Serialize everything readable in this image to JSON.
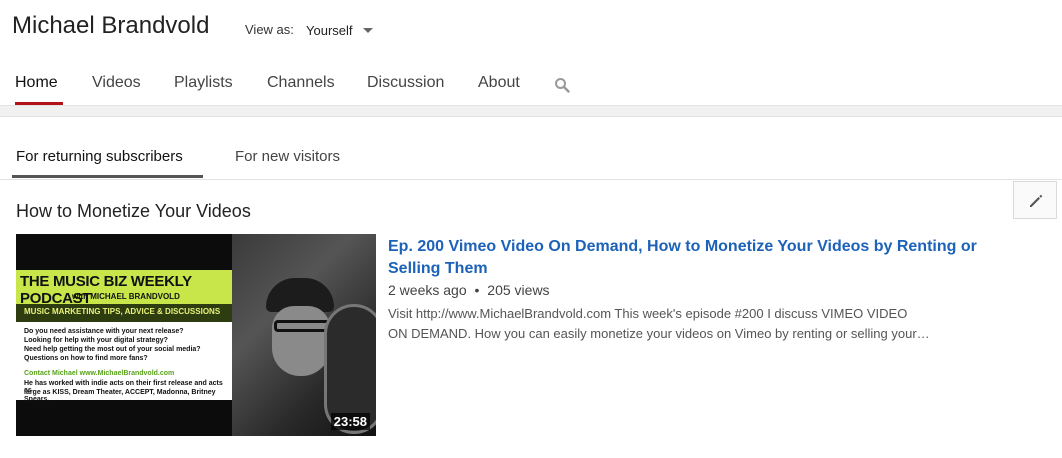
{
  "channel": {
    "title": "Michael Brandvold",
    "view_as_label": "View as:",
    "view_as_value": "Yourself"
  },
  "nav": {
    "tabs": [
      "Home",
      "Videos",
      "Playlists",
      "Channels",
      "Discussion",
      "About"
    ],
    "active": "Home",
    "search_icon": "search-icon"
  },
  "subtabs": {
    "items": [
      "For returning subscribers",
      "For new visitors"
    ],
    "active": "For returning subscribers"
  },
  "section": {
    "title": "How to Monetize Your Videos",
    "edit_icon": "pencil-icon"
  },
  "video": {
    "title_line1": "Ep. 200 Vimeo Video On Demand, How to Monetize Your Videos by Renting or",
    "title_line2": "Selling Them",
    "age": "2 weeks ago",
    "separator": "•",
    "views": "205 views",
    "description_line1": "Visit http://www.MichaelBrandvold.com This week's episode #200 I discuss VIMEO VIDEO",
    "description_line2": "ON DEMAND. How you can easily monetize your videos on Vimeo by renting or selling your…",
    "duration": "23:58",
    "thumbnail": {
      "title": "THE MUSIC BIZ WEEKLY PODCAST",
      "subtitle": "with MICHAEL BRANDVOLD",
      "band": "MUSIC MARKETING TIPS, ADVICE & DISCUSSIONS",
      "q1": "Do you need assistance with your next release?",
      "q2": "Looking for help with your digital strategy?",
      "q3": "Need help getting the most out of your social media?",
      "q4": "Questions on how to find more fans?",
      "contact": "Contact Michael www.MichaelBrandvold.com",
      "bio1": "He has worked with indie acts on their first release and acts as",
      "bio2": "large as KISS, Dream Theater, ACCEPT, Madonna, Britney Spears."
    }
  }
}
